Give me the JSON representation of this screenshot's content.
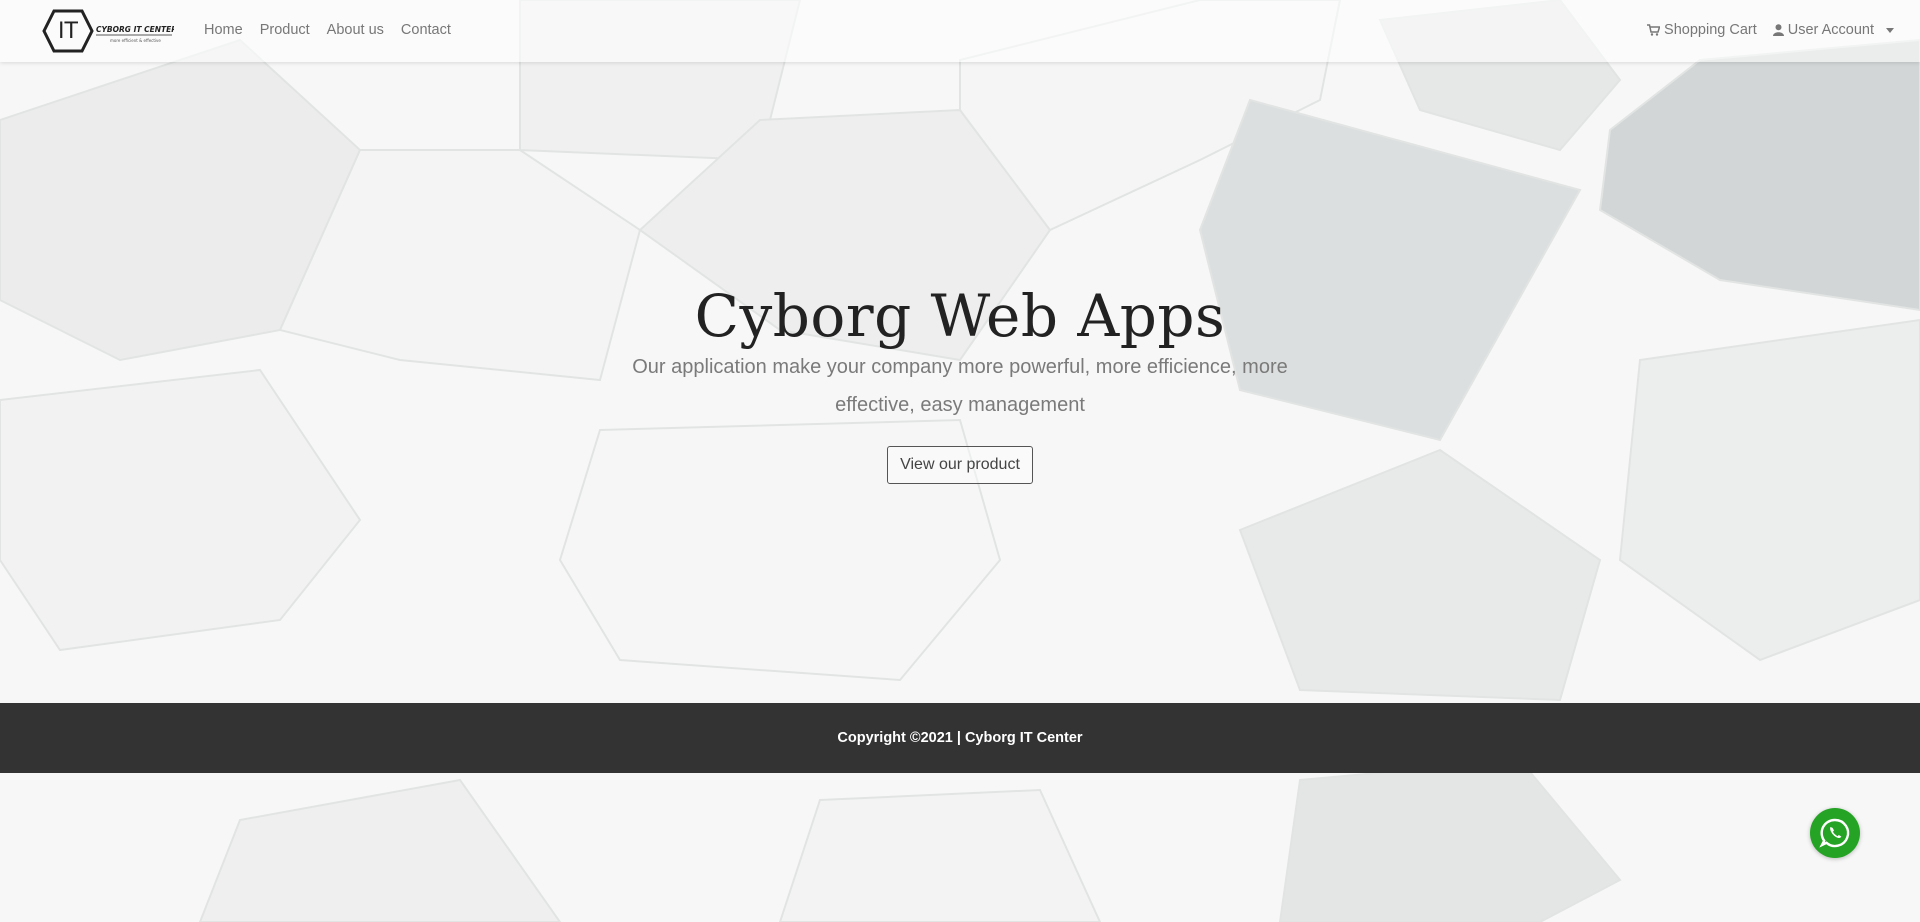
{
  "brand": {
    "logo_text": "IT",
    "name": "CYBORG IT CENTER",
    "tagline": "more efficient & effective"
  },
  "nav": {
    "left": [
      {
        "label": "Home"
      },
      {
        "label": "Product"
      },
      {
        "label": "About us"
      },
      {
        "label": "Contact"
      }
    ],
    "cart_label": "Shopping Cart",
    "account_label": "User Account"
  },
  "hero": {
    "title": "Cyborg Web Apps",
    "subtitle": "Our application make your company more powerful, more efficience, more effective, easy management",
    "cta_label": "View our product"
  },
  "footer": {
    "copyright": "Copyright ©2021 | Cyborg IT Center"
  },
  "colors": {
    "footer_bg": "#333333",
    "whatsapp": "#25a324",
    "nav_text": "#777777"
  },
  "icons": [
    "cart-icon",
    "user-icon",
    "whatsapp-icon"
  ]
}
